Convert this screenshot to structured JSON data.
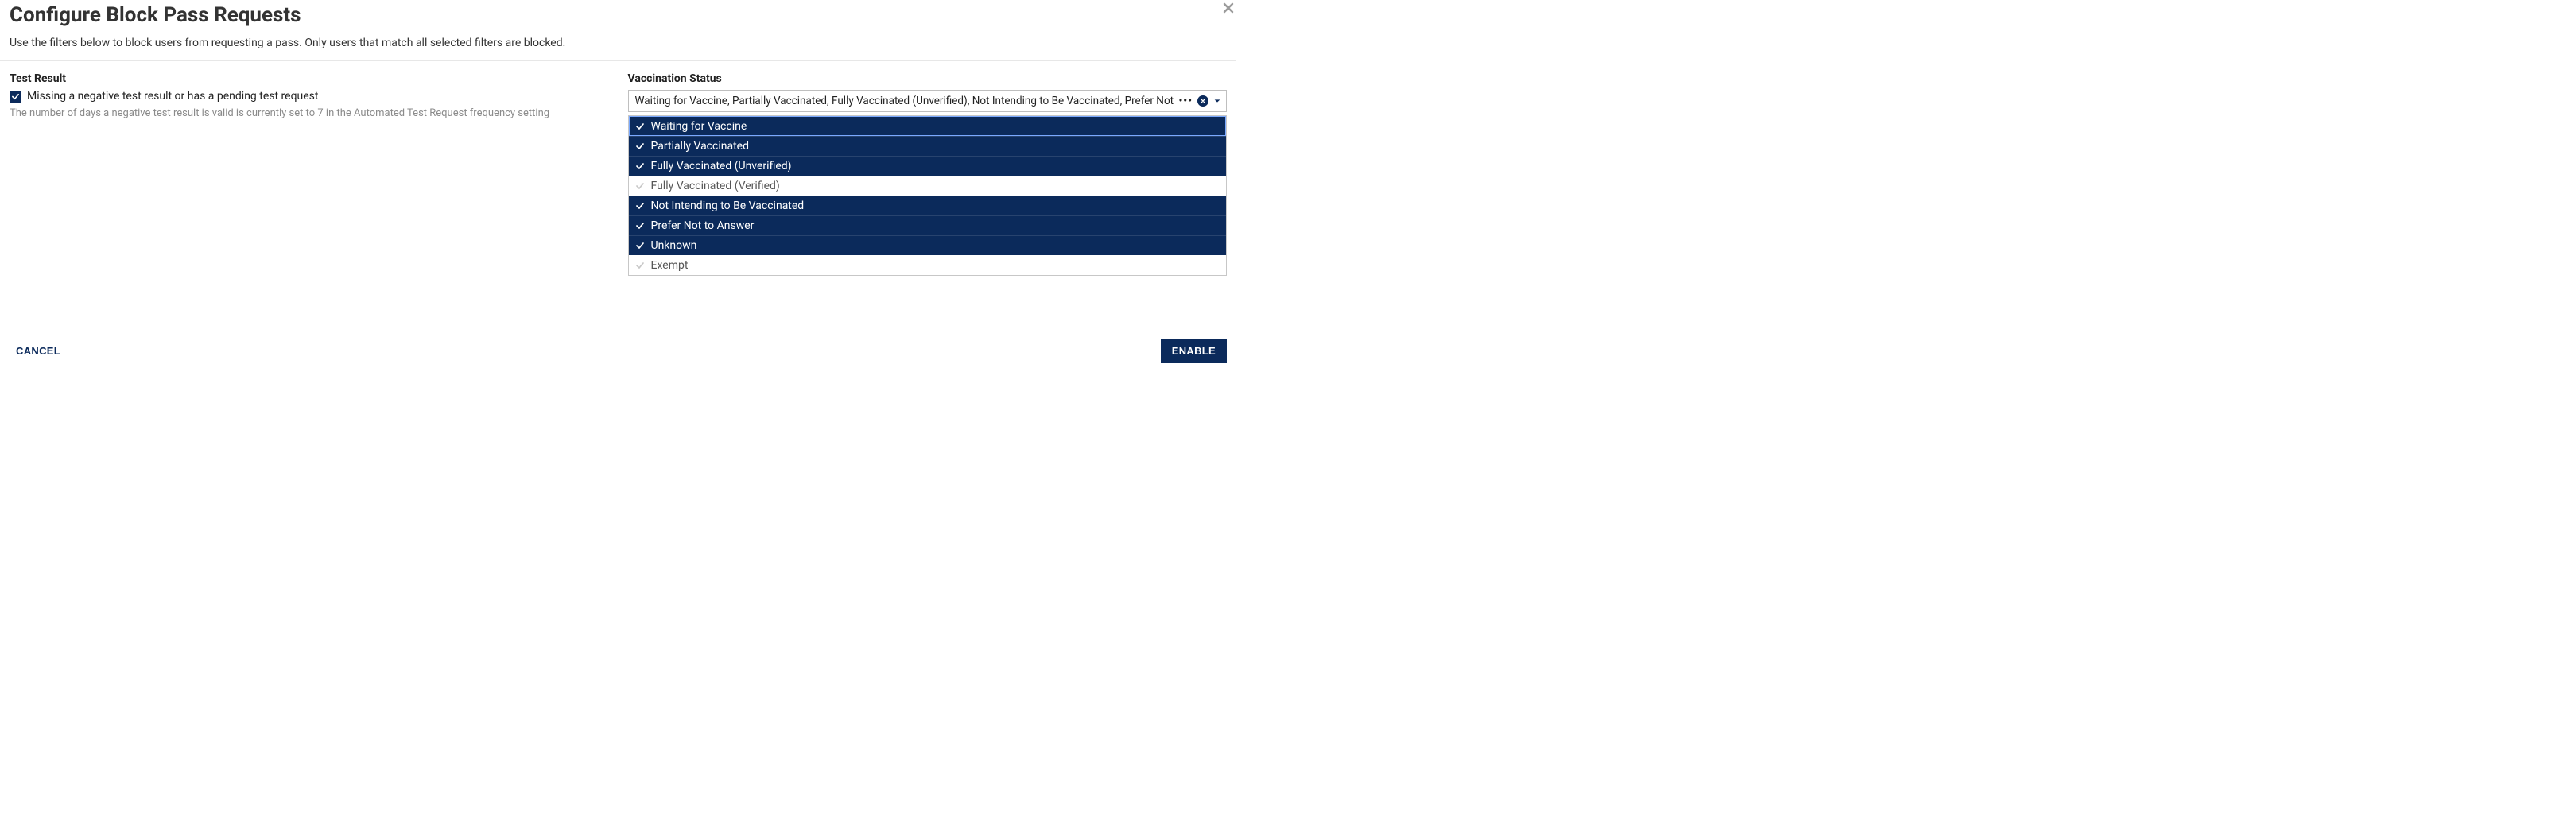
{
  "modal": {
    "title": "Configure Block Pass Requests",
    "subtitle": "Use the filters below to block users from requesting a pass. Only users that match all selected filters are blocked."
  },
  "test_result": {
    "section_label": "Test Result",
    "checkbox_checked": true,
    "checkbox_label": "Missing a negative test result or has a pending test request",
    "hint": "The number of days a negative test result is valid is currently set to 7 in the Automated Test Request frequency setting"
  },
  "vaccination": {
    "section_label": "Vaccination Status",
    "input_display_text": "Waiting for Vaccine, Partially Vaccinated, Fully Vaccinated (Unverified), Not Intending to Be Vaccinated, Prefer Not to Answer, ",
    "more_indicator": "•••",
    "options": [
      {
        "label": "Waiting for Vaccine",
        "selected": true,
        "focused": true
      },
      {
        "label": "Partially Vaccinated",
        "selected": true,
        "focused": false
      },
      {
        "label": "Fully Vaccinated (Unverified)",
        "selected": true,
        "focused": false
      },
      {
        "label": "Fully Vaccinated (Verified)",
        "selected": false,
        "focused": false
      },
      {
        "label": "Not Intending to Be Vaccinated",
        "selected": true,
        "focused": false
      },
      {
        "label": "Prefer Not to Answer",
        "selected": true,
        "focused": false
      },
      {
        "label": "Unknown",
        "selected": true,
        "focused": false
      },
      {
        "label": "Exempt",
        "selected": false,
        "focused": false
      }
    ]
  },
  "footer": {
    "cancel_label": "CANCEL",
    "enable_label": "ENABLE"
  }
}
